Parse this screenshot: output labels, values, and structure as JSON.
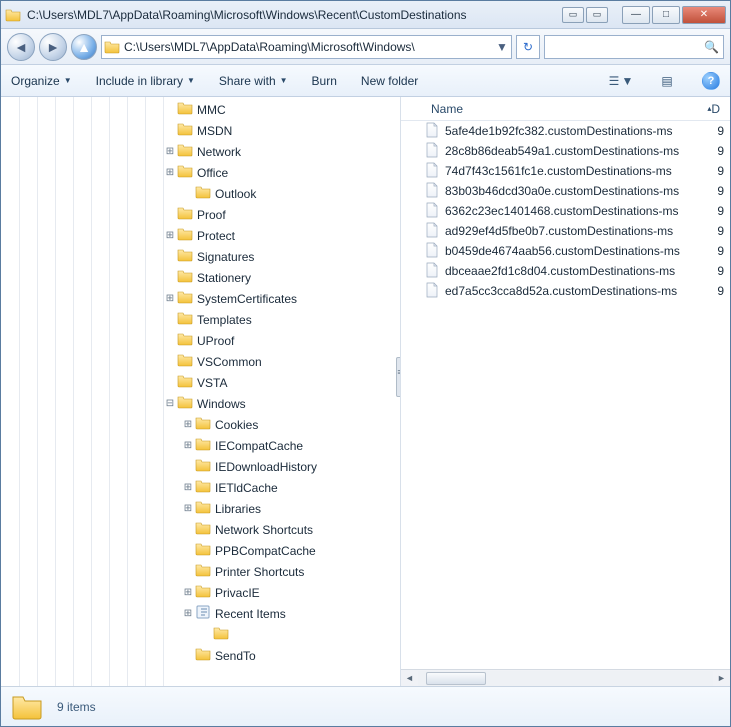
{
  "window": {
    "title": "C:\\Users\\MDL7\\AppData\\Roaming\\Microsoft\\Windows\\Recent\\CustomDestinations"
  },
  "address": {
    "path": "C:\\Users\\MDL7\\AppData\\Roaming\\Microsoft\\Windows\\"
  },
  "toolbar": {
    "organize": "Organize",
    "include": "Include in library",
    "share": "Share with",
    "burn": "Burn",
    "newfolder": "New folder"
  },
  "columns": {
    "name": "Name",
    "d": "D"
  },
  "tree": [
    {
      "indent": 9,
      "exp": "",
      "label": "MMC"
    },
    {
      "indent": 9,
      "exp": "",
      "label": "MSDN"
    },
    {
      "indent": 9,
      "exp": "+",
      "label": "Network"
    },
    {
      "indent": 9,
      "exp": "+",
      "label": "Office"
    },
    {
      "indent": 10,
      "exp": "",
      "label": "Outlook"
    },
    {
      "indent": 9,
      "exp": "",
      "label": "Proof"
    },
    {
      "indent": 9,
      "exp": "+",
      "label": "Protect"
    },
    {
      "indent": 9,
      "exp": "",
      "label": "Signatures"
    },
    {
      "indent": 9,
      "exp": "",
      "label": "Stationery"
    },
    {
      "indent": 9,
      "exp": "+",
      "label": "SystemCertificates"
    },
    {
      "indent": 9,
      "exp": "",
      "label": "Templates"
    },
    {
      "indent": 9,
      "exp": "",
      "label": "UProof"
    },
    {
      "indent": 9,
      "exp": "",
      "label": "VSCommon"
    },
    {
      "indent": 9,
      "exp": "",
      "label": "VSTA"
    },
    {
      "indent": 9,
      "exp": "-",
      "label": "Windows"
    },
    {
      "indent": 10,
      "exp": "+",
      "label": "Cookies"
    },
    {
      "indent": 10,
      "exp": "+",
      "label": "IECompatCache"
    },
    {
      "indent": 10,
      "exp": "",
      "label": "IEDownloadHistory"
    },
    {
      "indent": 10,
      "exp": "+",
      "label": "IETldCache"
    },
    {
      "indent": 10,
      "exp": "+",
      "label": "Libraries"
    },
    {
      "indent": 10,
      "exp": "",
      "label": "Network Shortcuts"
    },
    {
      "indent": 10,
      "exp": "",
      "label": "PPBCompatCache"
    },
    {
      "indent": 10,
      "exp": "",
      "label": "Printer Shortcuts"
    },
    {
      "indent": 10,
      "exp": "+",
      "label": "PrivacIE"
    },
    {
      "indent": 10,
      "exp": "+",
      "label": "Recent Items",
      "icon": "recent"
    },
    {
      "indent": 11,
      "exp": "",
      "label": ""
    },
    {
      "indent": 10,
      "exp": "",
      "label": "SendTo"
    }
  ],
  "files": [
    {
      "name": "5afe4de1b92fc382.customDestinations-ms",
      "d": "9"
    },
    {
      "name": "28c8b86deab549a1.customDestinations-ms",
      "d": "9"
    },
    {
      "name": "74d7f43c1561fc1e.customDestinations-ms",
      "d": "9"
    },
    {
      "name": "83b03b46dcd30a0e.customDestinations-ms",
      "d": "9"
    },
    {
      "name": "6362c23ec1401468.customDestinations-ms",
      "d": "9"
    },
    {
      "name": "ad929ef4d5fbe0b7.customDestinations-ms",
      "d": "9"
    },
    {
      "name": "b0459de4674aab56.customDestinations-ms",
      "d": "9"
    },
    {
      "name": "dbceaae2fd1c8d04.customDestinations-ms",
      "d": "9"
    },
    {
      "name": "ed7a5cc3cca8d52a.customDestinations-ms",
      "d": "9"
    }
  ],
  "status": {
    "count": "9 items"
  }
}
